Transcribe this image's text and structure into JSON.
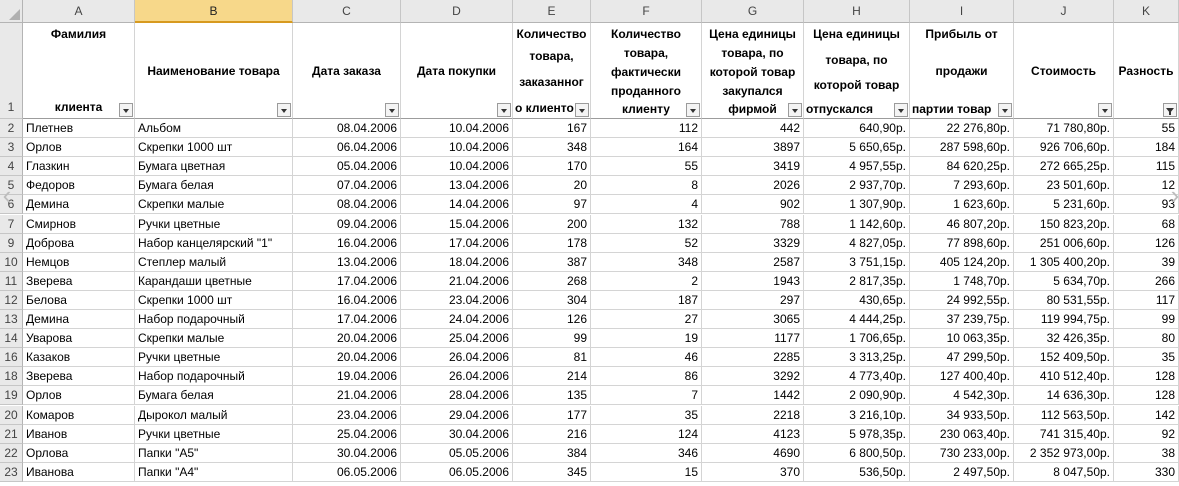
{
  "columns": [
    "A",
    "B",
    "C",
    "D",
    "E",
    "F",
    "G",
    "H",
    "I",
    "J",
    "K"
  ],
  "header_row_number": "1",
  "headers": [
    {
      "text": "Фамилия клиента"
    },
    {
      "text": "Наименование товара"
    },
    {
      "text": "Дата заказа"
    },
    {
      "text": "Дата покупки"
    },
    {
      "text": "Количество товара, заказанног о клиенто"
    },
    {
      "text": "Количество товара, фактически проданного клиенту"
    },
    {
      "text": "Цена единицы товара, по которой товар закупался фирмой"
    },
    {
      "text": "Цена единицы товара, по которой товар отпускался"
    },
    {
      "text": "Прибыль от продажи партии товар"
    },
    {
      "text": "Стоимость"
    },
    {
      "text": "Разность"
    }
  ],
  "header_line_split": {
    "col0_top": "Фамилия",
    "col0_bottom": "клиента",
    "col4": [
      "Количество",
      "товара,",
      "заказанног",
      "о клиенто"
    ],
    "col5": [
      "Количество",
      "товара,",
      "фактически",
      "проданного",
      "клиенту"
    ],
    "col6": [
      "Цена единицы",
      "товара, по",
      "которой товар",
      "закупался",
      "фирмой"
    ],
    "col7": [
      "Цена единицы",
      "товара, по",
      "которой товар",
      "отпускался"
    ],
    "col8": [
      "Прибыль от",
      "продажи",
      "партии товар"
    ]
  },
  "rows": [
    {
      "n": "2",
      "cells": [
        "Плетнев",
        "Альбом",
        "08.04.2006",
        "10.04.2006",
        "167",
        "112",
        "442",
        "640,90р.",
        "22 276,80р.",
        "71 780,80р.",
        "55"
      ]
    },
    {
      "n": "3",
      "cells": [
        "Орлов",
        "Скрепки 1000 шт",
        "06.04.2006",
        "10.04.2006",
        "348",
        "164",
        "3897",
        "5 650,65р.",
        "287 598,60р.",
        "926 706,60р.",
        "184"
      ]
    },
    {
      "n": "4",
      "cells": [
        "Глазкин",
        "Бумага цветная",
        "05.04.2006",
        "10.04.2006",
        "170",
        "55",
        "3419",
        "4 957,55р.",
        "84 620,25р.",
        "272 665,25р.",
        "115"
      ]
    },
    {
      "n": "5",
      "cells": [
        "Федоров",
        "Бумага белая",
        "07.04.2006",
        "13.04.2006",
        "20",
        "8",
        "2026",
        "2 937,70р.",
        "7 293,60р.",
        "23 501,60р.",
        "12"
      ]
    },
    {
      "n": "6",
      "cells": [
        "Демина",
        "Скрепки малые",
        "08.04.2006",
        "14.04.2006",
        "97",
        "4",
        "902",
        "1 307,90р.",
        "1 623,60р.",
        "5 231,60р.",
        "93"
      ]
    },
    {
      "n": "7",
      "cells": [
        "Смирнов",
        "Ручки цветные",
        "09.04.2006",
        "15.04.2006",
        "200",
        "132",
        "788",
        "1 142,60р.",
        "46 807,20р.",
        "150 823,20р.",
        "68"
      ]
    },
    {
      "n": "9",
      "cells": [
        "Доброва",
        "Набор канцелярский \"1\"",
        "16.04.2006",
        "17.04.2006",
        "178",
        "52",
        "3329",
        "4 827,05р.",
        "77 898,60р.",
        "251 006,60р.",
        "126"
      ]
    },
    {
      "n": "10",
      "cells": [
        "Немцов",
        "Степлер малый",
        "13.04.2006",
        "18.04.2006",
        "387",
        "348",
        "2587",
        "3 751,15р.",
        "405 124,20р.",
        "1 305 400,20р.",
        "39"
      ]
    },
    {
      "n": "11",
      "cells": [
        "Зверева",
        "Карандаши цветные",
        "17.04.2006",
        "21.04.2006",
        "268",
        "2",
        "1943",
        "2 817,35р.",
        "1 748,70р.",
        "5 634,70р.",
        "266"
      ]
    },
    {
      "n": "12",
      "cells": [
        "Белова",
        "Скрепки 1000 шт",
        "16.04.2006",
        "23.04.2006",
        "304",
        "187",
        "297",
        "430,65р.",
        "24 992,55р.",
        "80 531,55р.",
        "117"
      ]
    },
    {
      "n": "13",
      "cells": [
        "Демина",
        "Набор подарочный",
        "17.04.2006",
        "24.04.2006",
        "126",
        "27",
        "3065",
        "4 444,25р.",
        "37 239,75р.",
        "119 994,75р.",
        "99"
      ]
    },
    {
      "n": "14",
      "cells": [
        "Уварова",
        "Скрепки малые",
        "20.04.2006",
        "25.04.2006",
        "99",
        "19",
        "1177",
        "1 706,65р.",
        "10 063,35р.",
        "32 426,35р.",
        "80"
      ]
    },
    {
      "n": "16",
      "cells": [
        "Казаков",
        "Ручки цветные",
        "20.04.2006",
        "26.04.2006",
        "81",
        "46",
        "2285",
        "3 313,25р.",
        "47 299,50р.",
        "152 409,50р.",
        "35"
      ]
    },
    {
      "n": "18",
      "cells": [
        "Зверева",
        "Набор подарочный",
        "19.04.2006",
        "26.04.2006",
        "214",
        "86",
        "3292",
        "4 773,40р.",
        "127 400,40р.",
        "410 512,40р.",
        "128"
      ]
    },
    {
      "n": "19",
      "cells": [
        "Орлов",
        "Бумага белая",
        "21.04.2006",
        "28.04.2006",
        "135",
        "7",
        "1442",
        "2 090,90р.",
        "4 542,30р.",
        "14 636,30р.",
        "128"
      ]
    },
    {
      "n": "20",
      "cells": [
        "Комаров",
        "Дырокол малый",
        "23.04.2006",
        "29.04.2006",
        "177",
        "35",
        "2218",
        "3 216,10р.",
        "34 933,50р.",
        "112 563,50р.",
        "142"
      ]
    },
    {
      "n": "21",
      "cells": [
        "Иванов",
        "Ручки цветные",
        "25.04.2006",
        "30.04.2006",
        "216",
        "124",
        "4123",
        "5 978,35р.",
        "230 063,40р.",
        "741 315,40р.",
        "92"
      ]
    },
    {
      "n": "22",
      "cells": [
        "Орлова",
        "Папки \"А5\"",
        "30.04.2006",
        "05.05.2006",
        "384",
        "346",
        "4690",
        "6 800,50р.",
        "730 233,00р.",
        "2 352 973,00р.",
        "38"
      ]
    },
    {
      "n": "23",
      "cells": [
        "Иванова",
        "Папки \"А4\"",
        "06.05.2006",
        "06.05.2006",
        "345",
        "15",
        "370",
        "536,50р.",
        "2 497,50р.",
        "8 047,50р.",
        "330"
      ]
    }
  ]
}
